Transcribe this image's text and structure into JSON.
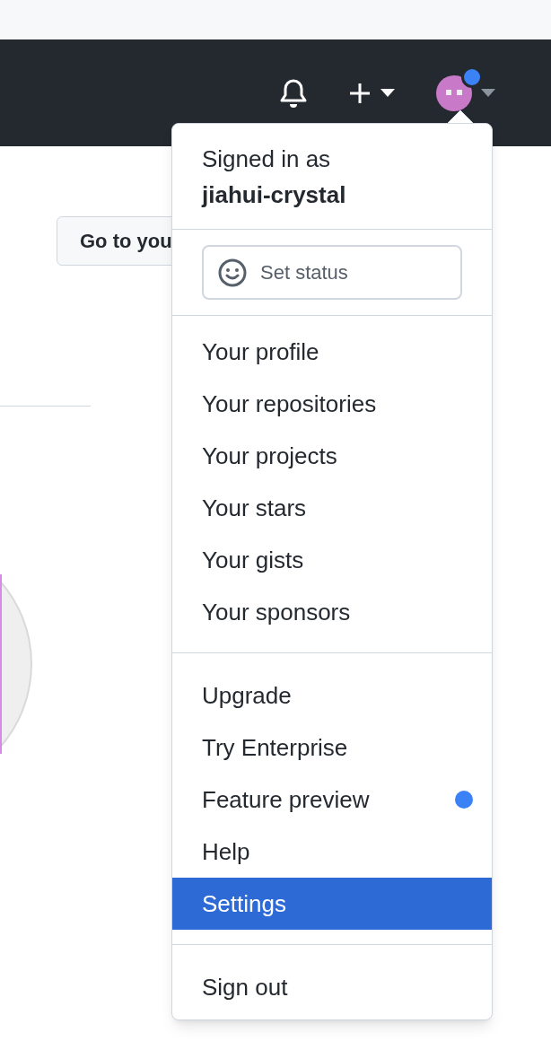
{
  "header": {
    "avatar": {
      "unread": true
    }
  },
  "page": {
    "button": "Go to you"
  },
  "menu": {
    "signed_in_label": "Signed in as",
    "username": "jiahui-crystal",
    "status_button": "Set status",
    "groups": [
      [
        {
          "label": "Your profile",
          "selected": false,
          "unread": false
        },
        {
          "label": "Your repositories",
          "selected": false,
          "unread": false
        },
        {
          "label": "Your projects",
          "selected": false,
          "unread": false
        },
        {
          "label": "Your stars",
          "selected": false,
          "unread": false
        },
        {
          "label": "Your gists",
          "selected": false,
          "unread": false
        },
        {
          "label": "Your sponsors",
          "selected": false,
          "unread": false
        }
      ],
      [
        {
          "label": "Upgrade",
          "selected": false,
          "unread": false
        },
        {
          "label": "Try Enterprise",
          "selected": false,
          "unread": false
        },
        {
          "label": "Feature preview",
          "selected": false,
          "unread": true
        },
        {
          "label": "Help",
          "selected": false,
          "unread": false
        },
        {
          "label": "Settings",
          "selected": true,
          "unread": false
        }
      ],
      [
        {
          "label": "Sign out",
          "selected": false,
          "unread": false
        }
      ]
    ]
  }
}
